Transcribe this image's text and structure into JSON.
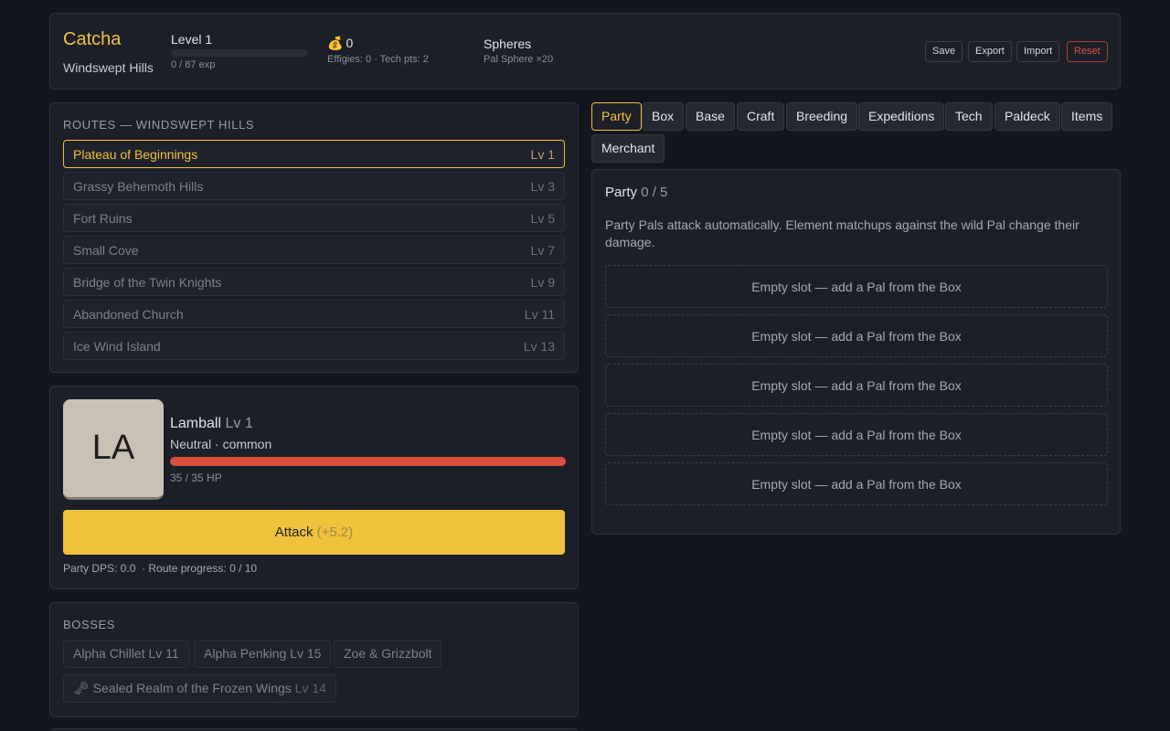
{
  "header": {
    "game_title": "Catcha",
    "area": "Windswept Hills",
    "level_label": "Level 1",
    "exp_text": "0 / 87 exp",
    "exp_progress": 0,
    "gold_icon": "money-bag-icon",
    "gold": "0",
    "effigies_text": "Effigies: 0 · Tech pts: 2",
    "spheres_label": "Spheres",
    "spheres_value": "Pal Sphere ×20",
    "buttons": {
      "save": "Save",
      "export": "Export",
      "import": "Import",
      "reset": "Reset"
    }
  },
  "routes": {
    "title": "Routes — Windswept Hills",
    "items": [
      {
        "name": "Plateau of Beginnings",
        "level": "Lv 1",
        "active": true
      },
      {
        "name": "Grassy Behemoth Hills",
        "level": "Lv 3"
      },
      {
        "name": "Fort Ruins",
        "level": "Lv 5"
      },
      {
        "name": "Small Cove",
        "level": "Lv 7"
      },
      {
        "name": "Bridge of the Twin Knights",
        "level": "Lv 9"
      },
      {
        "name": "Abandoned Church",
        "level": "Lv 11"
      },
      {
        "name": "Ice Wind Island",
        "level": "Lv 13"
      }
    ]
  },
  "battle": {
    "portrait_initials": "LA",
    "pal_name": "Lamball",
    "pal_level": "Lv 1",
    "pal_type": "Neutral · common",
    "hp_text": "35 / 35 HP",
    "hp_fraction": 1,
    "attack_label": "Attack",
    "attack_damage": "(+5.2)",
    "stats_text": "Party DPS: 0.0  · Route progress: 0 / 10"
  },
  "bosses": {
    "title": "Bosses",
    "items": [
      {
        "label": "Alpha Chillet Lv 11"
      },
      {
        "label": "Alpha Penking Lv 15"
      },
      {
        "label": "Zoe & Grizzbolt"
      }
    ],
    "sealed": {
      "icon": "🗝",
      "name": "Sealed Realm of the Frozen Wings",
      "level": "Lv 14"
    }
  },
  "tabs": [
    "Party",
    "Box",
    "Base",
    "Craft",
    "Breeding",
    "Expeditions",
    "Tech",
    "Paldeck",
    "Items",
    "Merchant"
  ],
  "active_tab": "Party",
  "party": {
    "title": "Party",
    "count": "0 / 5",
    "description": "Party Pals attack automatically. Element matchups against the wild Pal change their damage.",
    "slots": [
      "Empty slot — add a Pal from the Box",
      "Empty slot — add a Pal from the Box",
      "Empty slot — add a Pal from the Box",
      "Empty slot — add a Pal from the Box",
      "Empty slot — add a Pal from the Box"
    ]
  },
  "colors": {
    "accent": "#f0c23b",
    "hp": "#d9503f",
    "danger": "#e0564a",
    "background": "#14161d",
    "panel": "#1c1f28"
  }
}
